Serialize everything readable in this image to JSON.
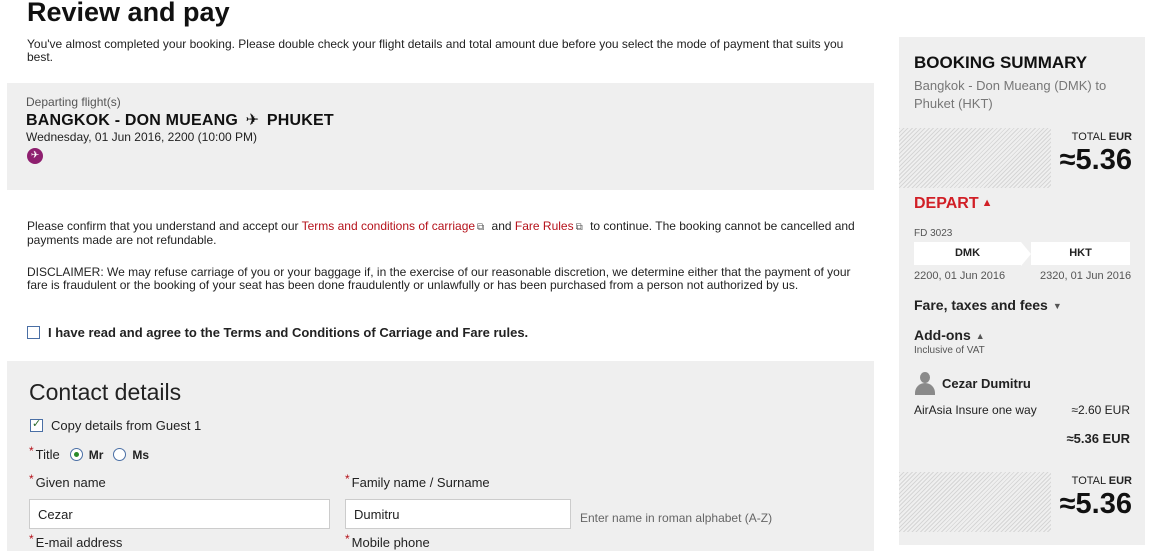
{
  "page": {
    "title": "Review and pay",
    "intro": "You've almost completed your booking. Please double check your flight details and total amount due before you select the mode of payment that suits you best."
  },
  "flight": {
    "label": "Departing flight(s)",
    "origin": "BANGKOK - DON MUEANG",
    "plane_glyph": "✈",
    "destination": "PHUKET",
    "date": "Wednesday, 01 Jun 2016, 2200 (10:00 PM)"
  },
  "confirm": {
    "prefix": "Please confirm that you understand and accept our",
    "terms_link": "Terms and conditions of carriage",
    "and": "and",
    "fare_link": "Fare Rules",
    "suffix": "to continue. The booking cannot be cancelled and payments made are not refundable."
  },
  "disclaimer": "DISCLAIMER: We may refuse carriage of you or your baggage if, in the exercise of our reasonable discretion, we determine either that the payment of your fare is fraudulent or the booking of your seat has been done fraudulently or unlawfully or has been purchased from a person not authorized by us.",
  "agree_label": "I have read and agree to the Terms and Conditions of Carriage and Fare rules.",
  "agree_checked": false,
  "contact": {
    "title": "Contact details",
    "copy_label": "Copy details from Guest 1",
    "copy_checked": true,
    "title_label": "Title",
    "title_options": [
      "Mr",
      "Ms"
    ],
    "title_selected": "Mr",
    "given_name_label": "Given name",
    "given_name_value": "Cezar",
    "family_name_label": "Family name / Surname",
    "family_name_value": "Dumitru",
    "name_hint": "Enter name in roman alphabet (A-Z)",
    "email_label": "E-mail address",
    "mobile_label": "Mobile phone",
    "required_mark": "*"
  },
  "summary": {
    "title": "BOOKING SUMMARY",
    "route": "Bangkok - Don Mueang (DMK) to Phuket (HKT)",
    "total_label": "TOTAL",
    "currency": "EUR",
    "total_amount": "≈5.36",
    "depart_label": "DEPART",
    "flight_no": "FD 3023",
    "from_code": "DMK",
    "to_code": "HKT",
    "dep_time": "2200, 01 Jun 2016",
    "arr_time": "2320, 01 Jun 2016",
    "fare_label": "Fare, taxes and fees",
    "addons_label": "Add-ons",
    "vat_label": "Inclusive of VAT",
    "guest_name": "Cezar Dumitru",
    "insurance_label": "AirAsia Insure one way",
    "insurance_amount": "≈2.60 EUR",
    "subtotal": "≈5.36 EUR"
  },
  "colors": {
    "accent_red": "#d11f26",
    "link_red": "#b5121b",
    "panel_grey": "#efefef"
  }
}
